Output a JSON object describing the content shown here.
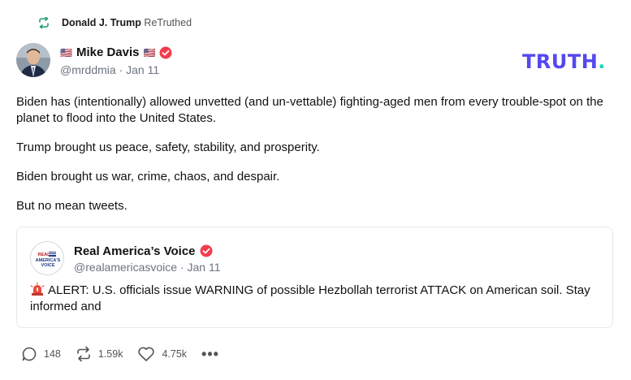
{
  "retruth": {
    "icon": "retruth-icon",
    "name": "Donald J. Trump",
    "action": "ReTruthed"
  },
  "author": {
    "flag_left": "🇺🇸",
    "name": "Mike Davis",
    "flag_right": "🇺🇸",
    "handle": "@mrddmia",
    "date": "Jan 11",
    "verified": true
  },
  "brand": {
    "logo_text": "TRUTH",
    "logo_dot": ".",
    "logo_color": "#5448ee",
    "dot_color": "#25d0b4"
  },
  "post": {
    "paragraphs": [
      "Biden has (intentionally) allowed unvetted (and un-vettable) fighting-aged men from every trouble-spot on the planet to flood into the United States.",
      "Trump brought us peace, safety, stability, and prosperity.",
      "Biden brought us war, crime, chaos, and despair.",
      "But no mean tweets."
    ]
  },
  "quote": {
    "name": "Real America’s Voice",
    "handle": "@realamericasvoice",
    "date": "Jan 11",
    "avatar_text_1": "REAL",
    "avatar_text_2": "AMERICA'S",
    "avatar_text_3": "VOICE",
    "icon": "siren-icon",
    "text": "ALERT: U.S. officials issue WARNING of possible Hezbollah terrorist ATTACK on American soil. Stay informed and"
  },
  "actions": {
    "replies": "148",
    "retruths": "1.59k",
    "likes": "4.75k",
    "more": "•••"
  },
  "colors": {
    "verified": "#f23d4e",
    "retruth_green": "#16a34a"
  }
}
